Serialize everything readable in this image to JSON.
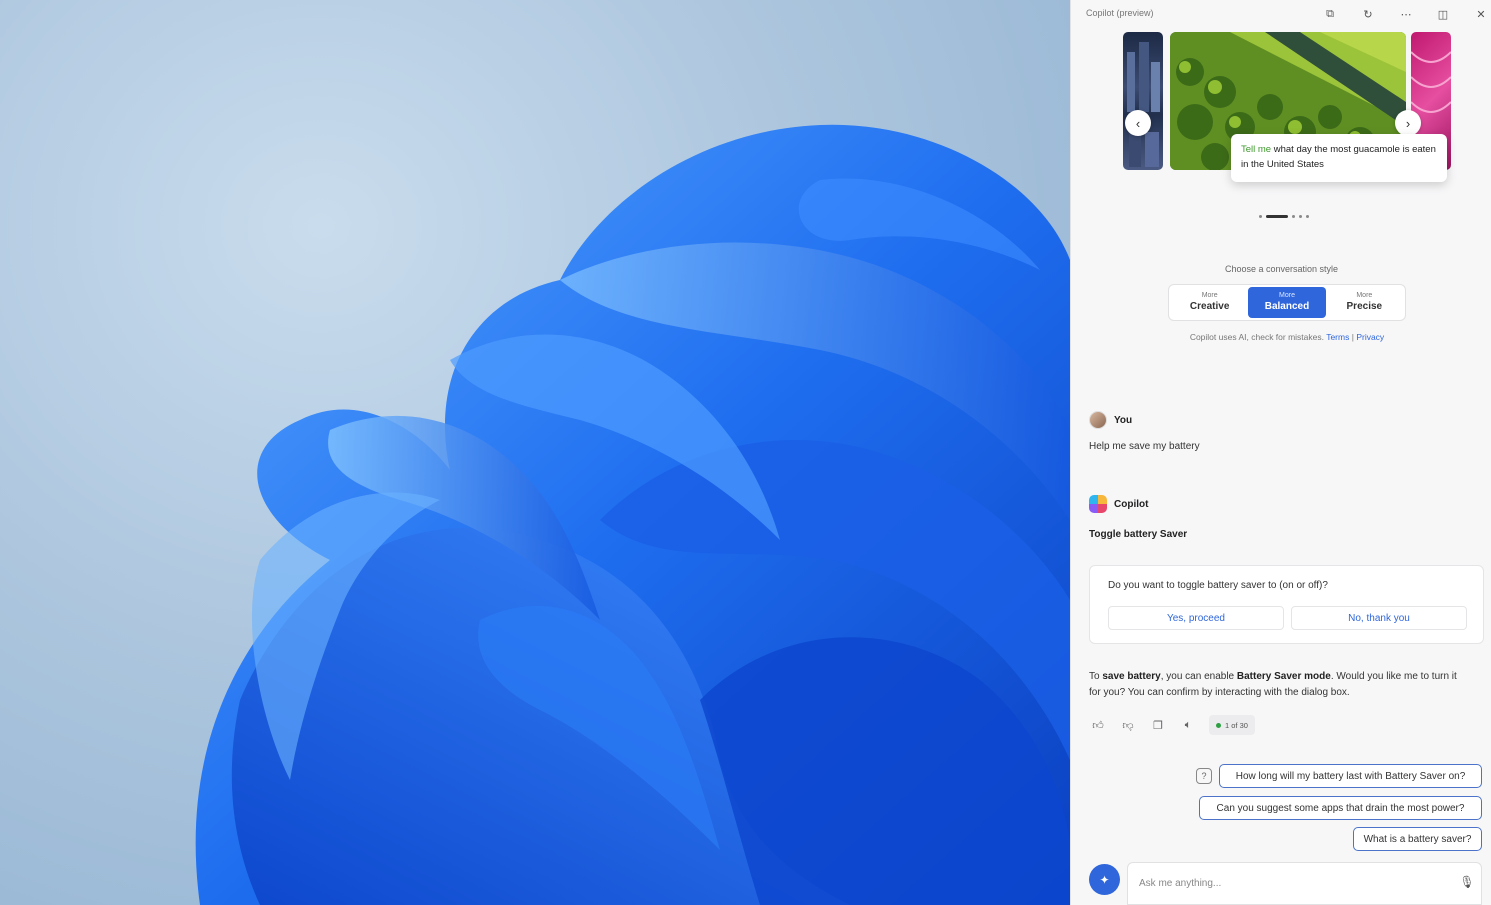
{
  "panel": {
    "title": "Copilot (preview)",
    "controls": [
      "open-external-icon",
      "refresh-icon",
      "more-icon",
      "dock-icon",
      "close-icon"
    ]
  },
  "carousel": {
    "caption_highlight": "Tell me",
    "caption_rest": " what day the most guacamole is eaten in the United States",
    "slide_count": 5,
    "active_slide": 1
  },
  "conversation_style": {
    "label": "Choose a conversation style",
    "options": [
      {
        "small": "More",
        "large": "Creative"
      },
      {
        "small": "More",
        "large": "Balanced"
      },
      {
        "small": "More",
        "large": "Precise"
      }
    ],
    "selected": 1
  },
  "disclaimer": {
    "text": "Copilot uses AI, check for mistakes.",
    "terms": "Terms",
    "separator": "|",
    "privacy": "Privacy"
  },
  "user_message": {
    "author": "You",
    "text": "Help me save my battery"
  },
  "copilot_message": {
    "author": "Copilot",
    "title": "Toggle battery Saver",
    "dialog": {
      "question": "Do you want to toggle battery saver to (on or off)?",
      "yes": "Yes, proceed",
      "no": "No, thank you"
    },
    "answer": {
      "p1": "To ",
      "b1": "save battery",
      "p2": ", you can enable ",
      "b2": "Battery Saver mode",
      "p3": ". Would you like me to turn it for you? You can confirm by interacting with the dialog box."
    },
    "counter": "1 of 30"
  },
  "suggestions": [
    "How long will my battery last with Battery Saver on?",
    "Can you suggest some apps that drain the most power?",
    "What is a battery saver?"
  ],
  "input": {
    "placeholder": "Ask me anything..."
  },
  "colors": {
    "accent": "#2f66db",
    "chip_border": "#4c73c9",
    "highlight_green": "#3f9a2e"
  }
}
